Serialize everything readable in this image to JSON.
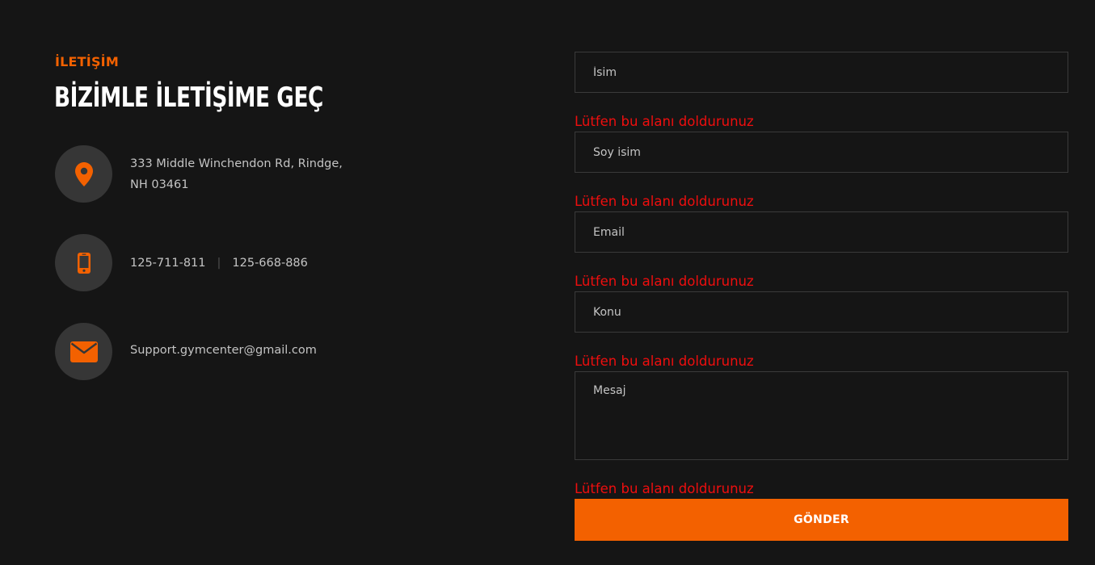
{
  "section": {
    "eyebrow": "İLETİŞİM",
    "title": "BİZİMLE İLETİŞİME GEÇ"
  },
  "contact": {
    "address_line1": "333 Middle Winchendon Rd, Rindge,",
    "address_line2": "NH 03461",
    "phone1": "125-711-811",
    "phone_separator": "|",
    "phone2": "125-668-886",
    "email": "Support.gymcenter@gmail.com",
    "icons": [
      "map-pin-icon",
      "mobile-phone-icon",
      "envelope-icon"
    ]
  },
  "form": {
    "first_name_placeholder": "İsim",
    "last_name_placeholder": "Soy isim",
    "email_placeholder": "Email",
    "subject_placeholder": "Konu",
    "message_placeholder": "Mesaj",
    "error_message": "Lütfen bu alanı doldurunuz",
    "submit_label": "GÖNDER"
  },
  "colors": {
    "accent": "#f36100",
    "background": "#151515",
    "error": "#ef0e0e",
    "icon_circle": "#363636"
  }
}
